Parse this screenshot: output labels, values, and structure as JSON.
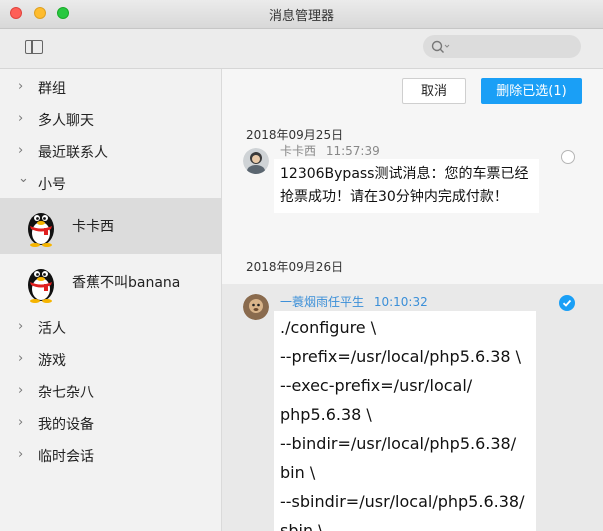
{
  "window": {
    "title": "消息管理器"
  },
  "toolbar": {
    "search_placeholder": ""
  },
  "sidebar": {
    "groups_top": [
      {
        "label": "群组",
        "expanded": false
      },
      {
        "label": "多人聊天",
        "expanded": false
      },
      {
        "label": "最近联系人",
        "expanded": false
      },
      {
        "label": "小号",
        "expanded": true
      }
    ],
    "contacts": [
      {
        "name": "卡卡西",
        "selected": true
      },
      {
        "name": "香蕉不叫banana",
        "selected": false
      }
    ],
    "groups_bottom": [
      {
        "label": "活人"
      },
      {
        "label": "游戏"
      },
      {
        "label": "杂七杂八"
      },
      {
        "label": "我的设备"
      },
      {
        "label": "临时会话"
      }
    ],
    "chevron_right": "›",
    "chevron_down": "⌄"
  },
  "actions": {
    "cancel": "取消",
    "delete_selected": "删除已选(1)"
  },
  "messages": [
    {
      "date": "2018年09月25日",
      "sender": "卡卡西",
      "time": "11:57:39",
      "lines": [
        "12306Bypass测试消息：您的车票已经",
        "抢票成功！请在30分钟内完成付款！"
      ],
      "checked": false
    },
    {
      "date": "2018年09月26日",
      "sender": "一蓑烟雨任平生",
      "time": "10:10:32",
      "lines": [
        "./configure  \\",
        "--prefix=/usr/local/php5.6.38  \\",
        "--exec-prefix=/usr/local/",
        "php5.6.38  \\",
        "--bindir=/usr/local/php5.6.38/",
        "bin  \\",
        "--sbindir=/usr/local/php5.6.38/",
        "sbin  \\"
      ],
      "checked": true
    }
  ],
  "colors": {
    "accent": "#1a9ff6",
    "sender_link": "#3b8fd8",
    "sender_muted": "#888888"
  }
}
